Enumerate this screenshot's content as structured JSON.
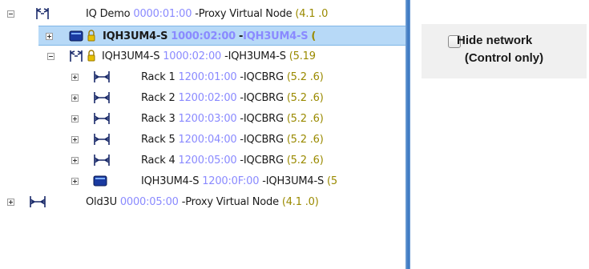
{
  "tree": {
    "rows": [
      {
        "name": "IQ Demo",
        "address": "0000:01:00",
        "sep": "-",
        "desc": "Proxy Virtual Node",
        "version": "(4.1 .0",
        "icon": "proxy-node-icon",
        "expander": "minus"
      },
      {
        "name": "IQH3UM4-S",
        "address": "1000:02:00",
        "sep": "-",
        "desc": "IQH3UM4-S",
        "version": "(",
        "icon": "device-card-icon",
        "expander": "plus",
        "selected": true
      },
      {
        "name": "IQH3UM4-S",
        "address": "1000:02:00",
        "sep": "-",
        "desc": "IQH3UM4-S",
        "version": "(5.19",
        "icon": "proxy-node-icon",
        "expander": "minus"
      },
      {
        "name": "Rack 1",
        "address": "1200:01:00",
        "sep": "-",
        "desc": "IQCBRG",
        "version": "(5.2 .6)",
        "icon": "rack-bridge-icon",
        "expander": "plus"
      },
      {
        "name": "Rack 2",
        "address": "1200:02:00",
        "sep": "-",
        "desc": "IQCBRG",
        "version": "(5.2 .6)",
        "icon": "rack-bridge-icon",
        "expander": "plus"
      },
      {
        "name": "Rack 3",
        "address": "1200:03:00",
        "sep": "-",
        "desc": "IQCBRG",
        "version": "(5.2 .6)",
        "icon": "rack-bridge-icon",
        "expander": "plus"
      },
      {
        "name": "Rack 5",
        "address": "1200:04:00",
        "sep": "-",
        "desc": "IQCBRG",
        "version": "(5.2 .6)",
        "icon": "rack-bridge-icon",
        "expander": "plus"
      },
      {
        "name": "Rack 4",
        "address": "1200:05:00",
        "sep": "-",
        "desc": "IQCBRG",
        "version": "(5.2 .6)",
        "icon": "rack-bridge-icon",
        "expander": "plus"
      },
      {
        "name": "IQH3UM4-S",
        "address": "1200:0F:00",
        "sep": "-",
        "desc": "IQH3UM4-S",
        "version": "(5",
        "icon": "device-card-icon",
        "expander": "plus"
      },
      {
        "name": "Old3U",
        "address": "0000:05:00",
        "sep": "-",
        "desc": "Proxy Virtual Node",
        "version": "(4.1 .0)",
        "icon": "rack-bridge-icon",
        "expander": "plus"
      }
    ]
  },
  "options": {
    "hide_network_line1": "Hide network",
    "hide_network_line2": "(Control only)",
    "hide_network_checked": false
  },
  "colors": {
    "address": "#8a8aff",
    "version": "#9a8a00",
    "selection": "#b7d9f7",
    "splitter": "#4e86c8"
  }
}
